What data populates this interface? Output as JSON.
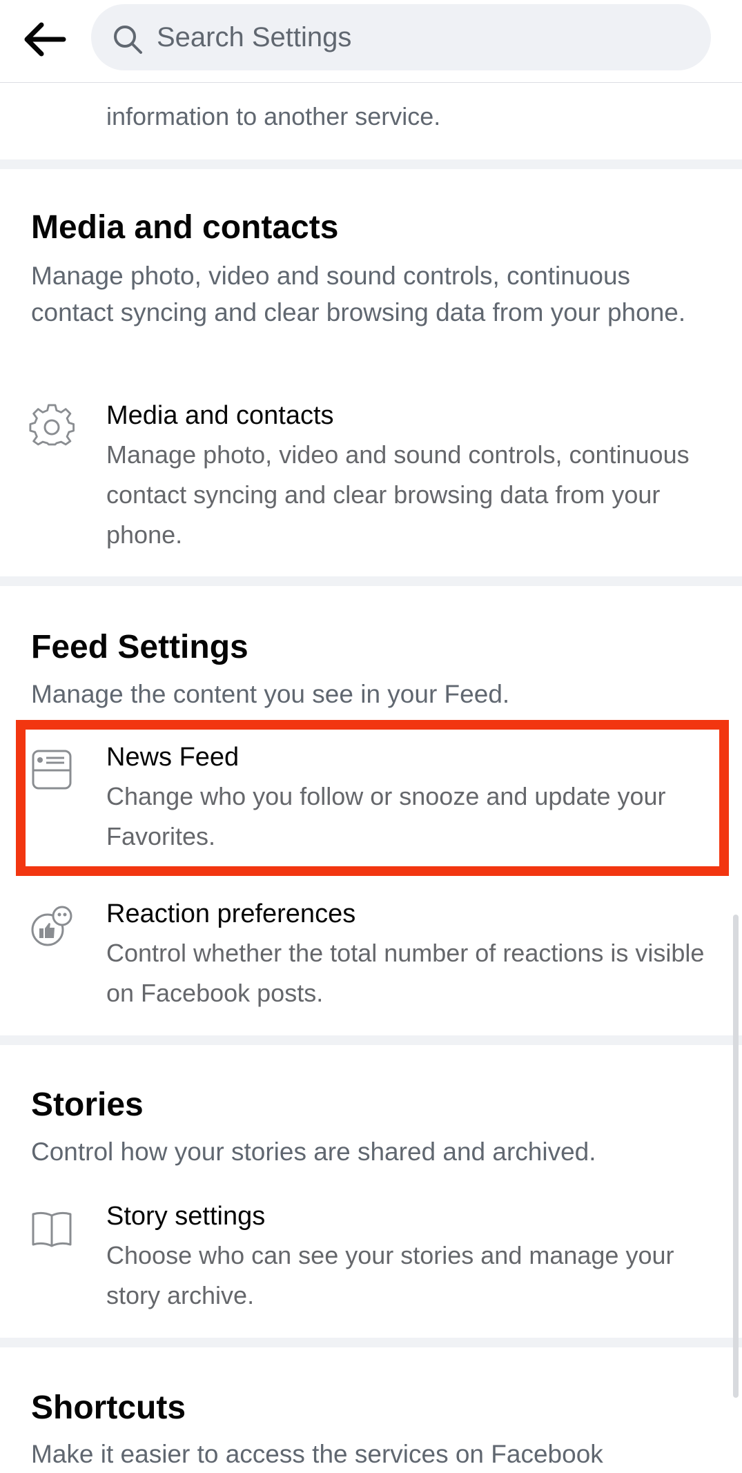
{
  "search": {
    "placeholder": "Search Settings"
  },
  "prev_section": {
    "tail_text": "information to another service."
  },
  "sections": {
    "media": {
      "title": "Media and contacts",
      "desc": "Manage photo, video and sound controls, continuous contact syncing and clear browsing data from your phone.",
      "items": [
        {
          "icon": "gear-icon",
          "title": "Media and contacts",
          "desc": "Manage photo, video and sound controls, continuous contact syncing and clear browsing data from your phone."
        }
      ]
    },
    "feed": {
      "title": "Feed Settings",
      "desc": "Manage the content you see in your Feed.",
      "items": [
        {
          "icon": "news-feed-icon",
          "title": "News Feed",
          "desc": "Change who you follow or snooze and update your Favorites."
        },
        {
          "icon": "reactions-icon",
          "title": "Reaction preferences",
          "desc": "Control whether the total number of reactions is visible on Facebook posts."
        }
      ]
    },
    "stories": {
      "title": "Stories",
      "desc": "Control how your stories are shared and archived.",
      "items": [
        {
          "icon": "book-icon",
          "title": "Story settings",
          "desc": "Choose who can see your stories and manage your story archive."
        }
      ]
    },
    "shortcuts": {
      "title": "Shortcuts",
      "desc": "Make it easier to access the services on Facebook"
    }
  },
  "colors": {
    "highlight": "#f23610",
    "divider": "#f0f2f5",
    "secondary_text": "#65676b"
  }
}
